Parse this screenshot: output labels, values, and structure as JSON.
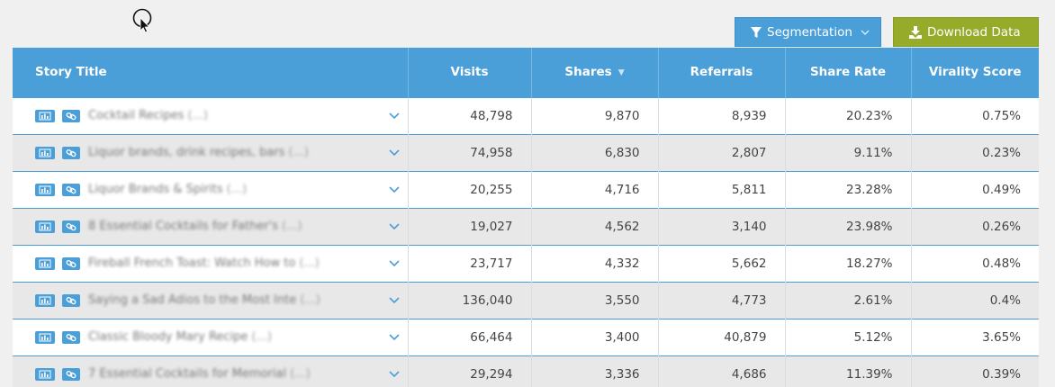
{
  "toolbar": {
    "segmentation_label": "Segmentation",
    "download_label": "Download Data"
  },
  "colors": {
    "header_blue": "#4a9fd9",
    "download_green": "#96ab2a"
  },
  "table": {
    "headers": {
      "title": "Story Title",
      "visits": "Visits",
      "shares": "Shares",
      "referrals": "Referrals",
      "share_rate": "Share Rate",
      "virality": "Virality Score"
    },
    "sorted_column": "Shares",
    "rows": [
      {
        "title": "Cocktail Recipes",
        "ellipsis": "(...)",
        "visits": "48,798",
        "shares": "9,870",
        "referrals": "8,939",
        "share_rate": "20.23%",
        "virality": "0.75%"
      },
      {
        "title": "Liquor brands, drink recipes, bars",
        "ellipsis": "(...)",
        "visits": "74,958",
        "shares": "6,830",
        "referrals": "2,807",
        "share_rate": "9.11%",
        "virality": "0.23%"
      },
      {
        "title": "Liquor Brands & Spirits",
        "ellipsis": "(...)",
        "visits": "20,255",
        "shares": "4,716",
        "referrals": "5,811",
        "share_rate": "23.28%",
        "virality": "0.49%"
      },
      {
        "title": "8 Essential Cocktails for Father's",
        "ellipsis": "(...)",
        "visits": "19,027",
        "shares": "4,562",
        "referrals": "3,140",
        "share_rate": "23.98%",
        "virality": "0.26%"
      },
      {
        "title": "Fireball French Toast: Watch How to",
        "ellipsis": "(...)",
        "visits": "23,717",
        "shares": "4,332",
        "referrals": "5,662",
        "share_rate": "18.27%",
        "virality": "0.48%"
      },
      {
        "title": "Saying a Sad Adios to the Most Inte",
        "ellipsis": "(...)",
        "visits": "136,040",
        "shares": "3,550",
        "referrals": "4,773",
        "share_rate": "2.61%",
        "virality": "0.4%"
      },
      {
        "title": "Classic Bloody Mary Recipe",
        "ellipsis": "(...)",
        "visits": "66,464",
        "shares": "3,400",
        "referrals": "40,879",
        "share_rate": "5.12%",
        "virality": "3.65%"
      },
      {
        "title": "7 Essential Cocktails for Memorial",
        "ellipsis": "(...)",
        "visits": "29,294",
        "shares": "3,336",
        "referrals": "4,686",
        "share_rate": "11.39%",
        "virality": "0.39%"
      }
    ]
  }
}
